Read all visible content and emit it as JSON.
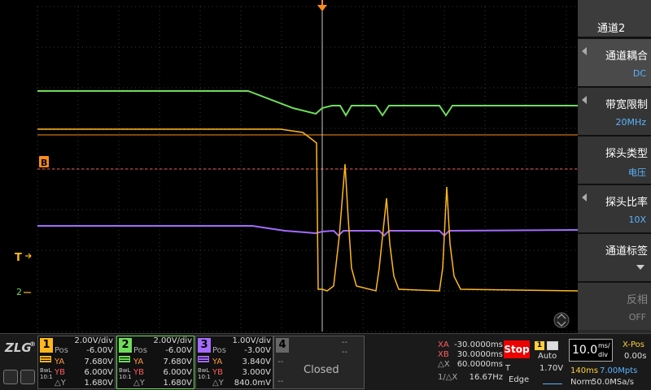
{
  "colors": {
    "ch1": "#ffb71c",
    "ch2": "#6fdc5a",
    "ch3": "#a46bff",
    "ch4": "#666666",
    "trigger_marker": "#ff8c1a",
    "cursor_line": "#c8c8c8",
    "stop": "#ee0000",
    "menu_value": "#5ab4ff"
  },
  "screen": {
    "marker_b": "B",
    "marker_t": "T",
    "marker_ch": "2"
  },
  "side_menu": {
    "title": "通道2",
    "items": [
      {
        "label": "通道耦合",
        "value": "DC"
      },
      {
        "label": "带宽限制",
        "value": "20MHz"
      },
      {
        "label": "探头类型",
        "value": "电压"
      },
      {
        "label": "探头比率",
        "value": "10X"
      },
      {
        "label": "通道标签",
        "value": ""
      },
      {
        "label": "反相",
        "value": "OFF"
      }
    ]
  },
  "bottom": {
    "logo": "ZLG",
    "logo_reg": "®",
    "bw_badge": "BwL 10:1",
    "ch1": {
      "num": "1",
      "vdiv": "2.00V/div",
      "pos_label": "Pos",
      "pos": "-6.00V",
      "ya_label": "YA",
      "ya": "7.680V",
      "yb_label": "YB",
      "yb": "6.000V",
      "dy_label": "△Y",
      "dy": "1.680V"
    },
    "ch2": {
      "num": "2",
      "vdiv": "2.00V/div",
      "pos_label": "Pos",
      "pos": "-6.00V",
      "ya_label": "YA",
      "ya": "7.680V",
      "yb_label": "YB",
      "yb": "6.000V",
      "dy_label": "△Y",
      "dy": "1.680V"
    },
    "ch3": {
      "num": "3",
      "vdiv": "1.00V/div",
      "pos_label": "Pos",
      "pos": "-3.00V",
      "ya_label": "YA",
      "ya": "3.840V",
      "yb_label": "YB",
      "yb": "3.000V",
      "dy_label": "△Y",
      "dy": "840.0mV"
    },
    "ch4": {
      "num": "4",
      "dash": "--",
      "status": "Closed"
    },
    "cursors": {
      "xa_label": "XA",
      "xa": "-30.0000ms",
      "xb_label": "XB",
      "xb": "30.0000ms",
      "dx_label": "△X",
      "dx": "60.0000ms",
      "inv_label": "1/△X",
      "inv": "16.67Hz"
    },
    "trigger": {
      "run_state": "Stop",
      "source": "1",
      "mode": "Auto",
      "level_label": "T",
      "level": "1.70V",
      "type": "Edge"
    },
    "timebase": {
      "value": "10.0",
      "unit_top": "ms/",
      "unit_bot": "div",
      "xpos_label": "X-Pos",
      "xpos": "0.00s",
      "mem": "140ms",
      "points": "7.00Mpts",
      "acq_mode": "Norm",
      "rate": "50.0MSa/s"
    }
  }
}
